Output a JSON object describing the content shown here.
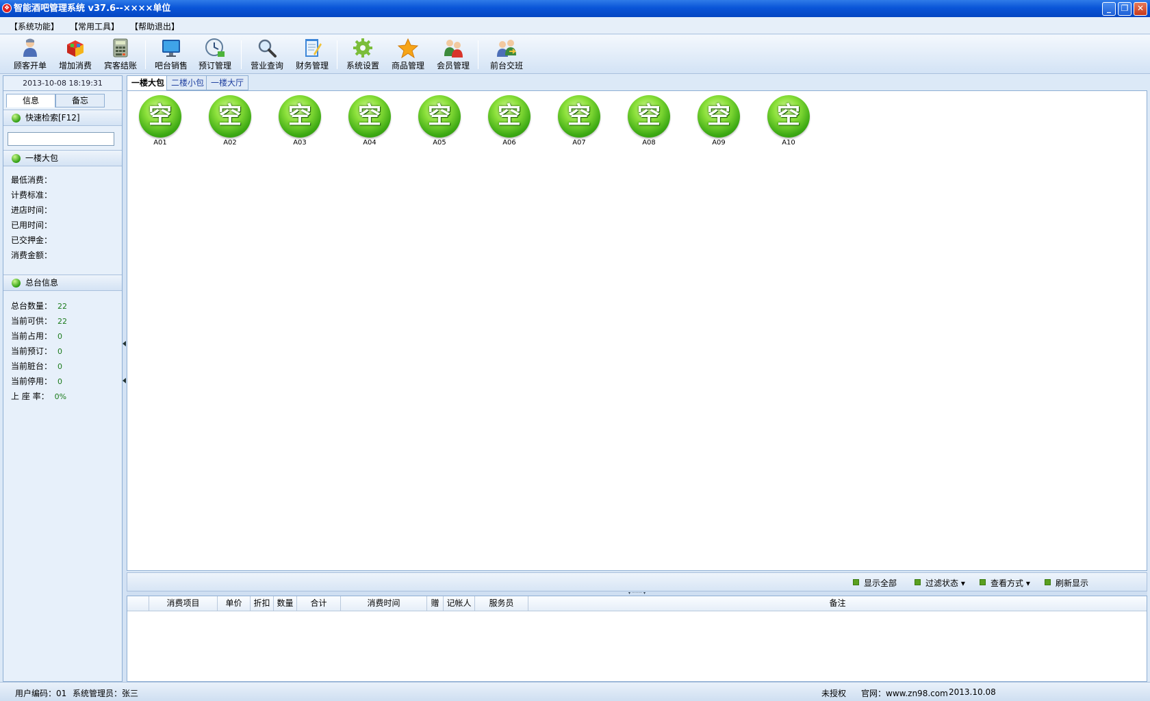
{
  "window": {
    "title": "智能酒吧管理系统 v37.6--××××单位",
    "minimize_glyph": "_",
    "restore_glyph": "❐",
    "close_glyph": "✕"
  },
  "menu": [
    "【系统功能】",
    "【常用工具】",
    "【帮助退出】"
  ],
  "toolbar": [
    {
      "label": "顾客开单",
      "icon": "customer-icon"
    },
    {
      "label": "增加消费",
      "icon": "add-consumption-icon"
    },
    {
      "label": "宾客结账",
      "icon": "checkout-calculator-icon"
    },
    {
      "label": "吧台销售",
      "icon": "monitor-icon"
    },
    {
      "label": "预订管理",
      "icon": "clock-icon"
    },
    {
      "label": "营业查询",
      "icon": "magnifier-icon"
    },
    {
      "label": "财务管理",
      "icon": "notepad-icon"
    },
    {
      "label": "系统设置",
      "icon": "gear-icon"
    },
    {
      "label": "商品管理",
      "icon": "star-icon"
    },
    {
      "label": "会员管理",
      "icon": "members-icon"
    },
    {
      "label": "前台交班",
      "icon": "handover-icon"
    }
  ],
  "left": {
    "datetime": "2013-10-08 18:19:31",
    "tabs": [
      "信息",
      "备忘"
    ],
    "quick_search": {
      "title": "快速检索[F12]",
      "value": ""
    },
    "room_info": {
      "title": "一楼大包",
      "rows": [
        "最低消费：",
        "计费标准：",
        "进店时间：",
        "已用时间：",
        "已交押金：",
        "消费金额："
      ]
    },
    "summary": {
      "title": "总台信息",
      "rows": [
        {
          "label": "总台数量：",
          "value": "22"
        },
        {
          "label": "当前可供：",
          "value": "22"
        },
        {
          "label": "当前占用：",
          "value": "0"
        },
        {
          "label": "当前预订：",
          "value": "0"
        },
        {
          "label": "当前脏台：",
          "value": "0"
        },
        {
          "label": "当前停用：",
          "value": "0"
        },
        {
          "label": "上 座 率：",
          "value": "0%"
        }
      ]
    }
  },
  "main": {
    "tabs": [
      "一楼大包",
      "二楼小包",
      "一楼大厅"
    ],
    "room_status_glyph": "空",
    "rooms": [
      "A01",
      "A02",
      "A03",
      "A04",
      "A05",
      "A06",
      "A07",
      "A08",
      "A09",
      "A10"
    ],
    "actions": [
      {
        "label": "显示全部"
      },
      {
        "label": "过滤状态 ▾"
      },
      {
        "label": "查看方式 ▾"
      },
      {
        "label": "刷新显示"
      }
    ],
    "splitter_glyph": "▾ ········ ▾",
    "columns": [
      "",
      "消费项目",
      "单价",
      "折扣",
      "数量",
      "合计",
      "消费时间",
      "赠",
      "记帐人",
      "服务员",
      "备注"
    ]
  },
  "status": {
    "user_code": "用户编码：01",
    "operator": "系统管理员：张三",
    "license": "未授权",
    "website": "官网：www.zn98.com",
    "date": "2013.10.08"
  },
  "colors": {
    "title_bar": "#0a55d8",
    "room_available": "#3ca913",
    "panel_bg": "#e7f0fa"
  }
}
